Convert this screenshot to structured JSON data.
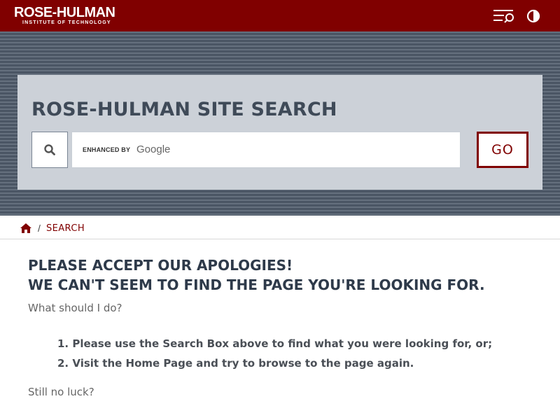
{
  "header": {
    "logo_main": "ROSE-HULMAN",
    "logo_sub": "INSTITUTE OF TECHNOLOGY",
    "menu_icon": "search-menu-icon",
    "contrast_icon": "contrast-icon",
    "brand_color": "#800000"
  },
  "search": {
    "title": "ROSE-HULMAN SITE SEARCH",
    "enhanced_by": "ENHANCED BY",
    "google": "Google",
    "go_label": "GO",
    "icon": "search-icon"
  },
  "breadcrumb": {
    "home_icon": "home-icon",
    "separator": "/",
    "current": "SEARCH"
  },
  "content": {
    "heading_line1": "PLEASE ACCEPT OUR APOLOGIES!",
    "heading_line2": "WE CAN'T SEEM TO FIND THE PAGE YOU'RE LOOKING FOR.",
    "question1": "What should I do?",
    "steps": [
      "1. Please use the Search Box above to find what you were looking for, or;",
      "2. Visit the Home Page and try to browse to the page again."
    ],
    "question2": "Still no luck?"
  }
}
